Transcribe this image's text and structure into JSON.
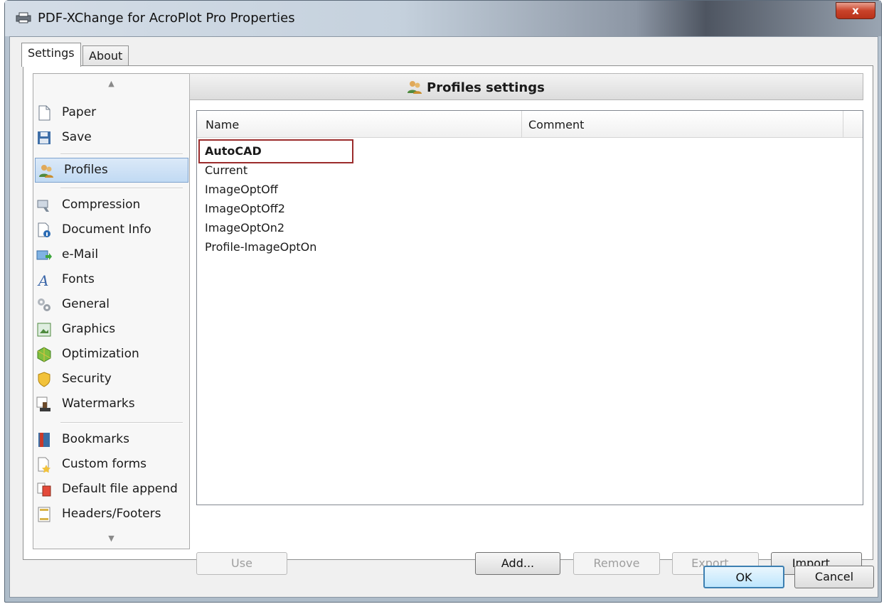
{
  "window": {
    "title": "PDF-XChange for AcroPlot Pro Properties",
    "close_label": "x"
  },
  "tabs": [
    {
      "label": "Settings"
    },
    {
      "label": "About"
    }
  ],
  "sidebar": {
    "items": [
      {
        "label": "Paper",
        "icon": "page-icon"
      },
      {
        "label": "Save",
        "icon": "floppy-disk-icon"
      },
      {
        "label": "Profiles",
        "icon": "users-icon"
      },
      {
        "label": "Compression",
        "icon": "compression-icon"
      },
      {
        "label": "Document Info",
        "icon": "document-info-icon"
      },
      {
        "label": "e-Mail",
        "icon": "email-icon"
      },
      {
        "label": "Fonts",
        "icon": "font-icon"
      },
      {
        "label": "General",
        "icon": "gears-icon"
      },
      {
        "label": "Graphics",
        "icon": "picture-icon"
      },
      {
        "label": "Optimization",
        "icon": "optimization-icon"
      },
      {
        "label": "Security",
        "icon": "shield-icon"
      },
      {
        "label": "Watermarks",
        "icon": "stamp-icon"
      },
      {
        "label": "Bookmarks",
        "icon": "bookmark-icon"
      },
      {
        "label": "Custom forms",
        "icon": "forms-icon"
      },
      {
        "label": "Default file append",
        "icon": "file-append-icon"
      },
      {
        "label": "Headers/Footers",
        "icon": "header-footer-icon"
      }
    ],
    "selected": "Profiles"
  },
  "panel": {
    "title": "Profiles settings",
    "columns": [
      "Name",
      "Comment"
    ],
    "profiles": [
      "AutoCAD",
      "Current",
      "ImageOptOff",
      "ImageOptOff2",
      "ImageOptOn2",
      "Profile-ImageOptOn"
    ],
    "selected_profile": "AutoCAD"
  },
  "buttons": {
    "use": "Use",
    "add": "Add...",
    "remove": "Remove",
    "export": "Export...",
    "import": "Import...",
    "ok": "OK",
    "cancel": "Cancel"
  },
  "colors": {
    "highlight_border": "#9b2c2c",
    "selection": "#c1daf3"
  }
}
